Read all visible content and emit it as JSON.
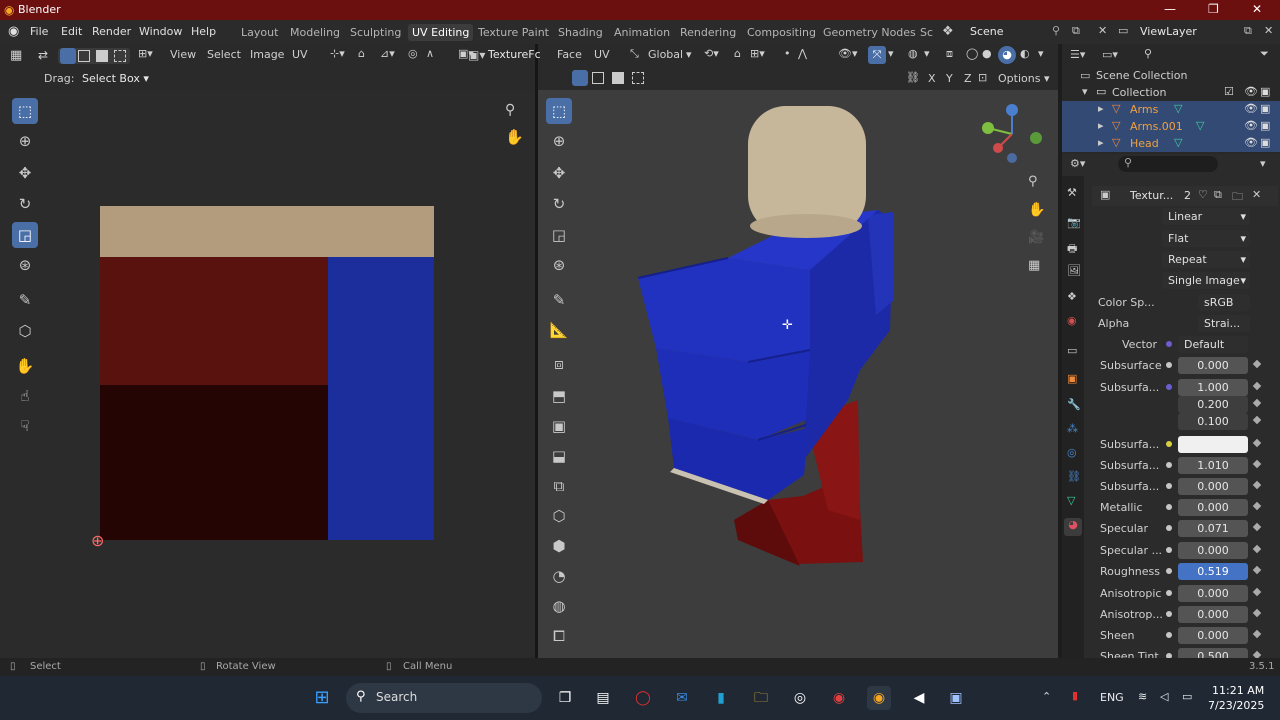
{
  "titlebar": {
    "app": "Blender",
    "min": "—",
    "max": "❐",
    "close": "✕"
  },
  "menu": [
    "File",
    "Edit",
    "Render",
    "Window",
    "Help"
  ],
  "workspaces": [
    "Layout",
    "Modeling",
    "Sculpting",
    "UV Editing",
    "Texture Paint",
    "Shading",
    "Animation",
    "Rendering",
    "Compositing",
    "Geometry Nodes",
    "Sc"
  ],
  "active_workspace": "UV Editing",
  "scene": "Scene",
  "view_layer": "ViewLayer",
  "uv_header": {
    "view": "View",
    "select": "Select",
    "image": "Image",
    "uv": "UV",
    "drag_label": "Drag:",
    "drag_value": "Select Box"
  },
  "vp_header": {
    "texture": "TextureFc",
    "face": "Face",
    "uv": "UV",
    "orientation": "Global",
    "options": "Options"
  },
  "axes": {
    "x": "X",
    "y": "Y",
    "z": "Z"
  },
  "outliner": {
    "root": "Scene Collection",
    "collection": "Collection",
    "items": [
      "Arms",
      "Arms.001",
      "Head"
    ]
  },
  "props": {
    "texture_label": "Textur...",
    "users": "2",
    "dropdowns": [
      "Linear",
      "Flat",
      "Repeat",
      "Single Image"
    ],
    "color_space_label": "Color Sp...",
    "color_space": "sRGB",
    "alpha_label": "Alpha",
    "alpha": "Strai...",
    "vector_label": "Vector",
    "vector": "Default",
    "rows": [
      {
        "label": "Subsurface",
        "value": "0.000"
      },
      {
        "label": "Subsurfa...",
        "value": "1.000"
      },
      {
        "label": "",
        "value": "0.200"
      },
      {
        "label": "",
        "value": "0.100"
      },
      {
        "label": "Subsurfa...",
        "value": ""
      },
      {
        "label": "Subsurfa...",
        "value": "1.010"
      },
      {
        "label": "Subsurfa...",
        "value": "0.000"
      },
      {
        "label": "Metallic",
        "value": "0.000"
      },
      {
        "label": "Specular",
        "value": "0.071"
      },
      {
        "label": "Specular ...",
        "value": "0.000"
      },
      {
        "label": "Roughness",
        "value": "0.519"
      },
      {
        "label": "Anisotropic",
        "value": "0.000"
      },
      {
        "label": "Anisotrop...",
        "value": "0.000"
      },
      {
        "label": "Sheen",
        "value": "0.000"
      },
      {
        "label": "Sheen Tint",
        "value": "0.500"
      }
    ]
  },
  "uv_texture": {
    "colors": {
      "skin": "#b39b7e",
      "red": "#5a120f",
      "dark": "#250404",
      "blue": "#1c2e9b"
    }
  },
  "status": {
    "select": "Select",
    "rotate": "Rotate View",
    "call_menu": "Call Menu",
    "version": "3.5.1"
  },
  "taskbar": {
    "search": "Search",
    "lang": "ENG",
    "time": "11:21 AM",
    "date": "7/23/2025"
  }
}
